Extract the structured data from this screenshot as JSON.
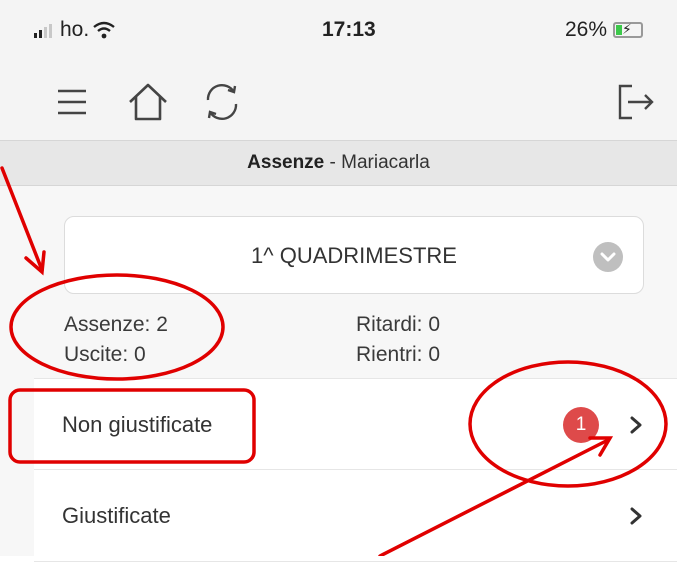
{
  "status_bar": {
    "carrier": "ho.",
    "time": "17:13",
    "battery": "26%",
    "battery_level": 0.26
  },
  "toolbar": {
    "menu_icon": "menu-icon",
    "home_icon": "home-icon",
    "refresh_icon": "refresh-icon",
    "logout_icon": "logout-icon"
  },
  "header": {
    "title_bold": "Assenze",
    "title_rest": " - Mariacarla"
  },
  "period_selector": {
    "value": "1^ QUADRIMESTRE",
    "icon": "chevron-down-icon"
  },
  "stats": {
    "assenze": "Assenze: 2",
    "uscite": "Uscite: 0",
    "ritardi": "Ritardi: 0",
    "rientri": "Rientri: 0"
  },
  "list": {
    "items": [
      {
        "label": "Non giustificate",
        "badge": "1"
      },
      {
        "label": "Giustificate"
      }
    ]
  },
  "colors": {
    "badge": "#de4a4a",
    "annotation": "#e00000",
    "toolbar_bg": "#f4f4f4",
    "content_bg": "#f7f7f7"
  }
}
